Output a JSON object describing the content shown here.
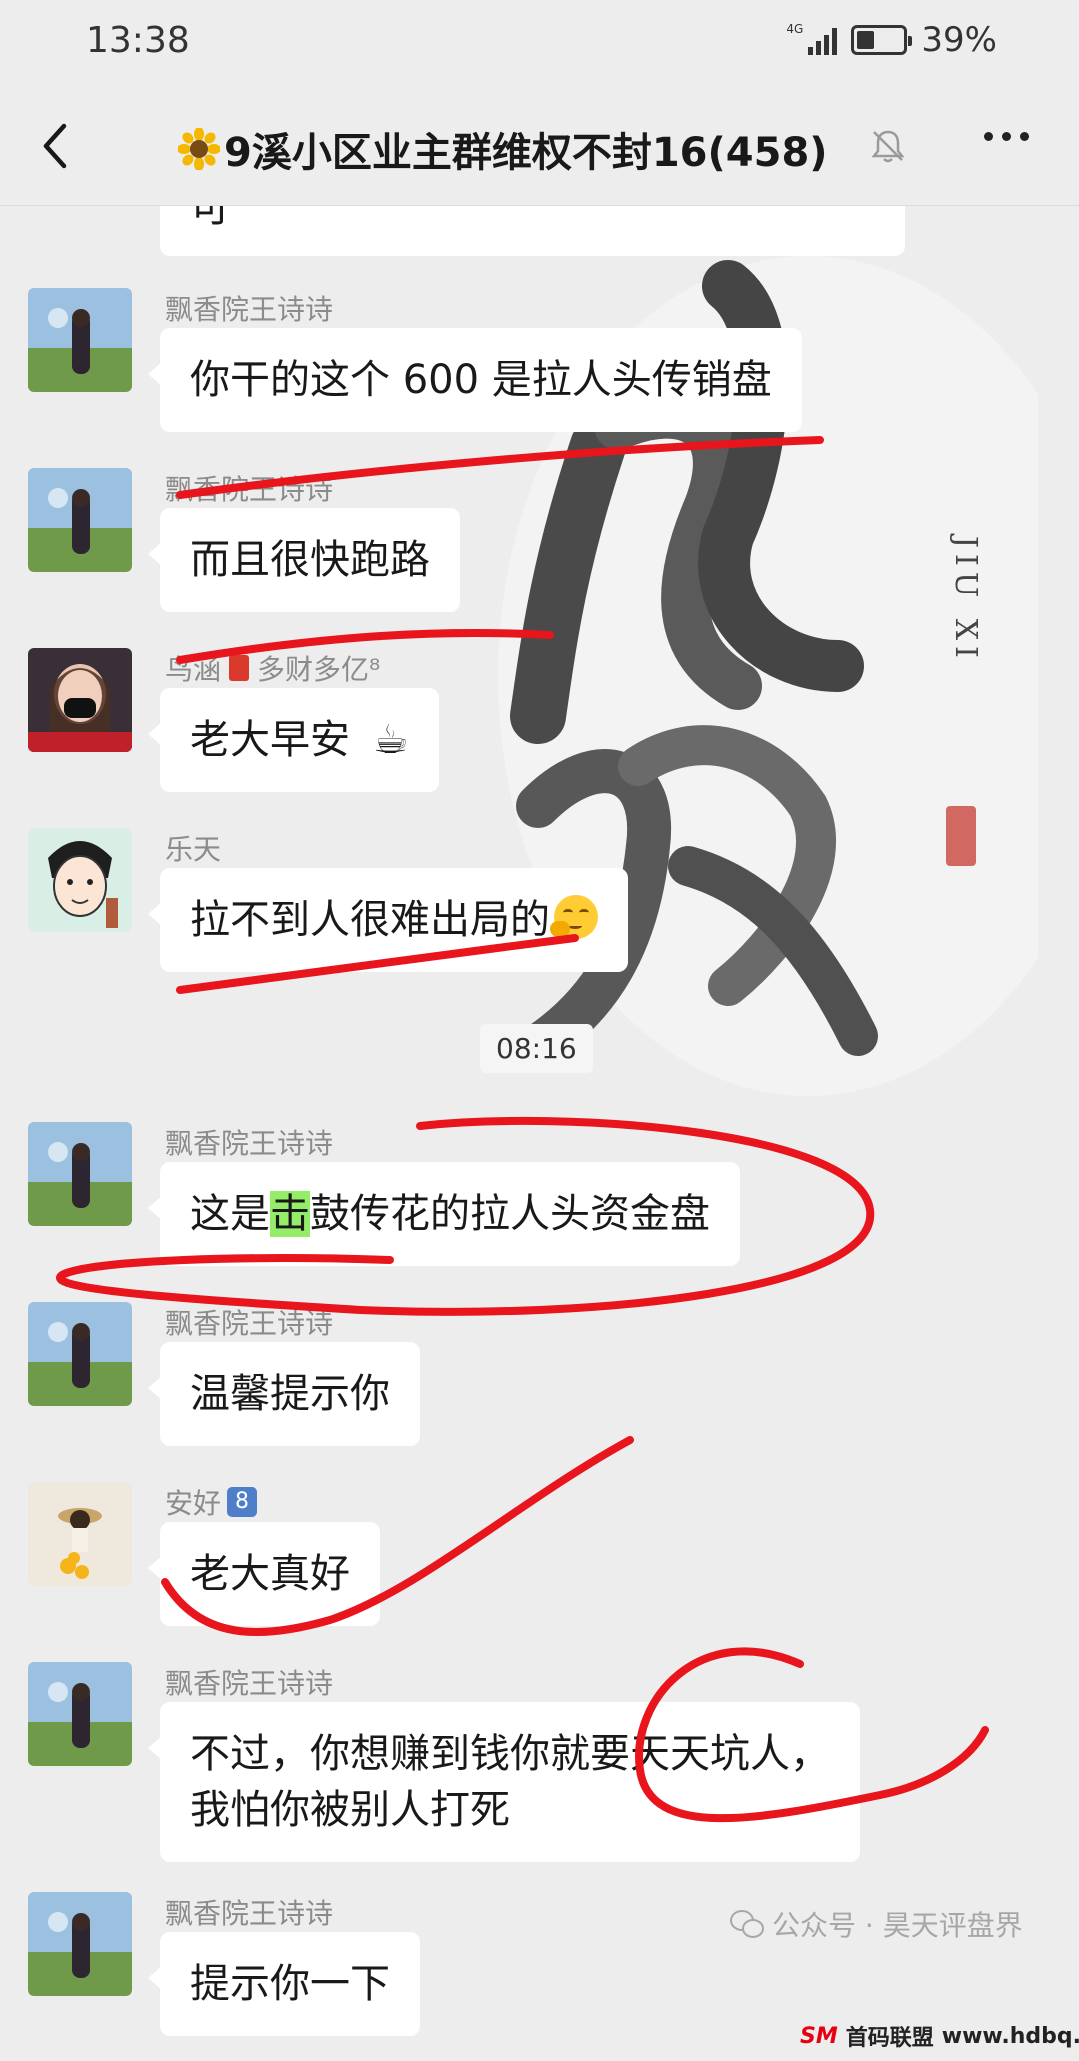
{
  "status_bar": {
    "time": "13:38",
    "network": "4G",
    "battery_percent": "39%",
    "battery_level": 0.39
  },
  "header": {
    "title": "9溪小区业主群维权不封16(458)",
    "title_icon": "sunflower-icon",
    "mute_icon": "bell-off-icon",
    "more_icon": "more-dots-icon",
    "back_icon": "chevron-left-icon"
  },
  "watermark": {
    "text": "JIU XI"
  },
  "messages": [
    {
      "sender": "",
      "text": "可",
      "partial": true
    },
    {
      "sender": "飘香院王诗诗",
      "text": "你干的这个 600 是拉人头传销盘"
    },
    {
      "sender": "飘香院王诗诗",
      "text": "而且很快跑路"
    },
    {
      "sender": "鸟涵",
      "sender_suffix": "多财多亿⁸",
      "text": "老大早安",
      "emoji": "☕"
    },
    {
      "sender": "乐天",
      "text": "拉不到人很难出局的",
      "emoji": "thinking-face-icon"
    },
    {
      "sender": "飘香院王诗诗",
      "text_before": "这是",
      "text_highlight": "击",
      "text_after": "鼓传花的拉人头资金盘"
    },
    {
      "sender": "飘香院王诗诗",
      "text": "温馨提示你"
    },
    {
      "sender": "安好",
      "sender_badge": "8",
      "text": "老大真好"
    },
    {
      "sender": "飘香院王诗诗",
      "line1": "不过，你想赚到钱你就要天天坑人，",
      "line2": "我怕你被别人打死"
    },
    {
      "sender": "飘香院王诗诗",
      "text": "提示你一下"
    }
  ],
  "timestamp": "08:16",
  "footer": {
    "credit": "公众号 · 昊天评盘界",
    "site_logo": "SM",
    "site_name": "首码联盟",
    "site_url": "www.hdbq.cc"
  },
  "colors": {
    "background": "#ededed",
    "bubble": "#ffffff",
    "highlight": "#95ec69",
    "annotation_red": "#e8151d"
  }
}
